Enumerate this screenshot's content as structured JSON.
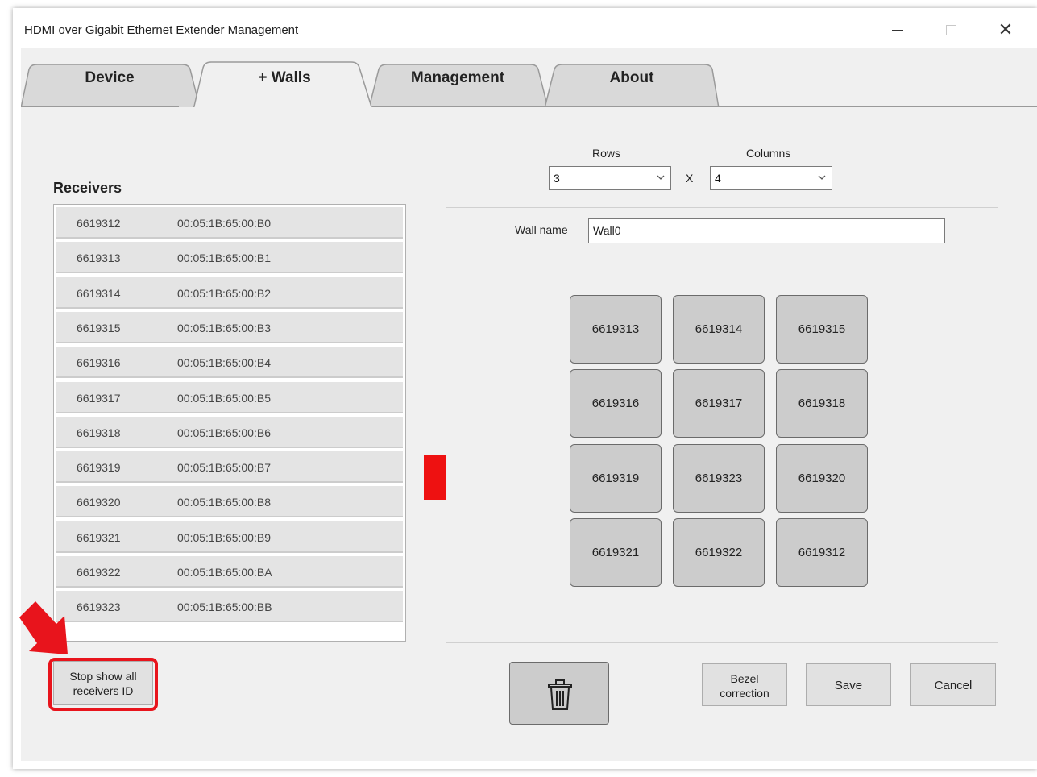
{
  "window": {
    "title": "HDMI over Gigabit Ethernet Extender Management",
    "controls": {
      "minimize": "minimize",
      "maximize": "maximize",
      "close": "✕"
    }
  },
  "tabs": [
    {
      "label": "Device"
    },
    {
      "label": "+ Walls",
      "active": true
    },
    {
      "label": "Management"
    },
    {
      "label": "About"
    }
  ],
  "receivers": {
    "label": "Receivers",
    "items": [
      {
        "id": "6619312",
        "mac": "00:05:1B:65:00:B0"
      },
      {
        "id": "6619313",
        "mac": "00:05:1B:65:00:B1"
      },
      {
        "id": "6619314",
        "mac": "00:05:1B:65:00:B2"
      },
      {
        "id": "6619315",
        "mac": "00:05:1B:65:00:B3"
      },
      {
        "id": "6619316",
        "mac": "00:05:1B:65:00:B4"
      },
      {
        "id": "6619317",
        "mac": "00:05:1B:65:00:B5"
      },
      {
        "id": "6619318",
        "mac": "00:05:1B:65:00:B6"
      },
      {
        "id": "6619319",
        "mac": "00:05:1B:65:00:B7"
      },
      {
        "id": "6619320",
        "mac": "00:05:1B:65:00:B8"
      },
      {
        "id": "6619321",
        "mac": "00:05:1B:65:00:B9"
      },
      {
        "id": "6619322",
        "mac": "00:05:1B:65:00:BA"
      },
      {
        "id": "6619323",
        "mac": "00:05:1B:65:00:BB"
      }
    ]
  },
  "grid_size": {
    "rows_label": "Rows",
    "rows_value": "3",
    "separator": "X",
    "columns_label": "Columns",
    "columns_value": "4"
  },
  "wall": {
    "name_label": "Wall name",
    "name_value": "Wall0",
    "tiles": [
      [
        "6619313",
        "6619314",
        "6619315"
      ],
      [
        "6619316",
        "6619317",
        "6619318"
      ],
      [
        "6619319",
        "6619323",
        "6619320"
      ],
      [
        "6619321",
        "6619322",
        "6619312"
      ]
    ]
  },
  "buttons": {
    "stop_show_line1": "Stop show all",
    "stop_show_line2": "receivers ID",
    "bezel_line1": "Bezel",
    "bezel_line2": "correction",
    "save": "Save",
    "cancel": "Cancel"
  },
  "icons": {
    "delete": "trash-icon",
    "chevron": "chevron-down-icon"
  },
  "colors": {
    "highlight_red": "#e8141c",
    "tile_gray": "#cccccc",
    "panel_bg": "#f0f0f0"
  }
}
